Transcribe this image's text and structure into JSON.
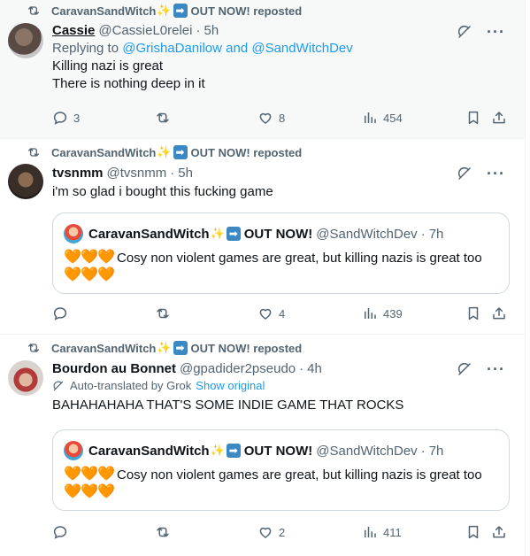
{
  "feed": {
    "posts": [
      {
        "repost_by": "CaravanSandWitch",
        "repost_suffix": "OUT NOW! reposted",
        "author_name": "Cassie",
        "author_handle": "@CassieL0relei",
        "time": "5h",
        "replying_label": "Replying to ",
        "replying_to": "@GrishaDanilow and @SandWitchDev",
        "text_lines": [
          "Killing nazi is great",
          "There is nothing deep in it"
        ],
        "replies": "3",
        "reposts": "",
        "likes": "8",
        "views": "454"
      },
      {
        "repost_by": "CaravanSandWitch",
        "repost_suffix": "OUT NOW! reposted",
        "author_name": "tvsnmm",
        "author_handle": "@tvsnmm",
        "time": "5h",
        "text": "i'm so glad i bought this fucking game",
        "quote": {
          "name": "CaravanSandWitch",
          "name_suffix": "OUT NOW!",
          "handle": "@SandWitchDev",
          "time": "7h",
          "text": "Cosy non violent games are great, but killing nazis is great too"
        },
        "replies": "",
        "reposts": "",
        "likes": "4",
        "views": "439"
      },
      {
        "repost_by": "CaravanSandWitch",
        "repost_suffix": "OUT NOW! reposted",
        "author_name": "Bourdon au Bonnet",
        "author_handle": "@gpadider2pseudo",
        "time": "4h",
        "translated_label": "Auto-translated by Grok",
        "show_original": "Show original",
        "text": "BAHAHAHAHA THAT'S SOME INDIE GAME THAT ROCKS",
        "quote": {
          "name": "CaravanSandWitch",
          "name_suffix": "OUT NOW!",
          "handle": "@SandWitchDev",
          "time": "7h",
          "text": "Cosy non violent games are great, but killing nazis is great too"
        },
        "replies": "",
        "reposts": "",
        "likes": "2",
        "views": "411"
      }
    ]
  },
  "symbols": {
    "dot": "·",
    "sparkle": "✨",
    "arrow": "➡",
    "heart": "🧡",
    "more": "···"
  },
  "colors": {
    "link": "#1d9bf0",
    "muted": "#536471",
    "text": "#0f1419",
    "highlight_bg": "#f7f9f9",
    "border": "#cfd9de"
  }
}
